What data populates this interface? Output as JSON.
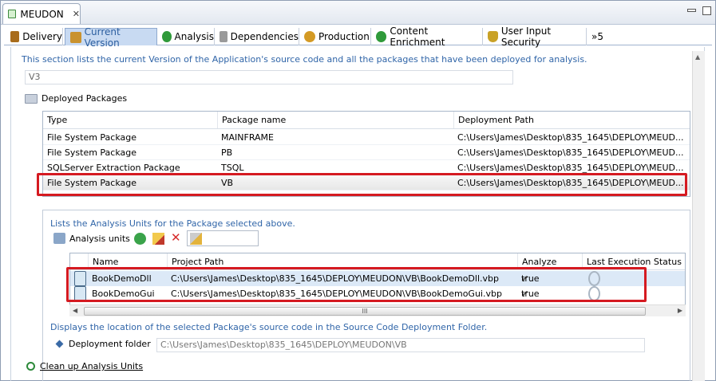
{
  "editor": {
    "title": "MEUDON",
    "close": "✕"
  },
  "tabs": [
    {
      "label": "Delivery",
      "icon": "truck-icon",
      "color": "#a86c1c"
    },
    {
      "label": "Current Version",
      "icon": "box-icon",
      "color": "#c9922e"
    },
    {
      "label": "Analysis",
      "icon": "refresh-icon",
      "color": "#2f9a3a"
    },
    {
      "label": "Dependencies",
      "icon": "link-icon",
      "color": "#777777"
    },
    {
      "label": "Production",
      "icon": "gears-icon",
      "color": "#d49a24"
    },
    {
      "label": "Content Enrichment",
      "icon": "plus-circle-icon",
      "color": "#2f9a3a"
    },
    {
      "label": "User Input Security",
      "icon": "shield-icon",
      "color": "#c9a227"
    }
  ],
  "tab_overflow": "»5",
  "description": "This section lists the current Version of the Application's source code and all the packages that have been deployed for analysis.",
  "version_value": "V3",
  "deployed_packages": {
    "label": "Deployed Packages",
    "columns": [
      "Type",
      "Package name",
      "Deployment Path"
    ],
    "rows": [
      [
        "File System Package",
        "MAINFRAME",
        "C:\\Users\\James\\Desktop\\835_1645\\DEPLOY\\MEUD..."
      ],
      [
        "File System Package",
        "PB",
        "C:\\Users\\James\\Desktop\\835_1645\\DEPLOY\\MEUD..."
      ],
      [
        "SQLServer Extraction Package",
        "TSQL",
        "C:\\Users\\James\\Desktop\\835_1645\\DEPLOY\\MEUD..."
      ],
      [
        "File System Package",
        "VB",
        "C:\\Users\\James\\Desktop\\835_1645\\DEPLOY\\MEUD..."
      ]
    ]
  },
  "analysis_units": {
    "description": "Lists the Analysis Units for the Package selected above.",
    "label": "Analysis units",
    "columns": [
      "Name",
      "Project Path",
      "Analyze",
      "Last Execution Status"
    ],
    "rows": [
      {
        "name": "BookDemoDll",
        "path": "C:\\Users\\James\\Desktop\\835_1645\\DEPLOY\\MEUDON\\VB\\BookDemoDll.vbp",
        "analyze": "true"
      },
      {
        "name": "BookDemoGui",
        "path": "C:\\Users\\James\\Desktop\\835_1645\\DEPLOY\\MEUDON\\VB\\BookDemoGui.vbp",
        "analyze": "true"
      }
    ],
    "scroll_thumb": "III"
  },
  "deployment": {
    "description": "Displays the location of the selected Package's source code in the Source Code Deployment Folder.",
    "label": "Deployment folder",
    "value": "C:\\Users\\James\\Desktop\\835_1645\\DEPLOY\\MEUDON\\VB"
  },
  "cleanup_link": "Clean up Analysis Units",
  "highlight_color": "#d51a21"
}
